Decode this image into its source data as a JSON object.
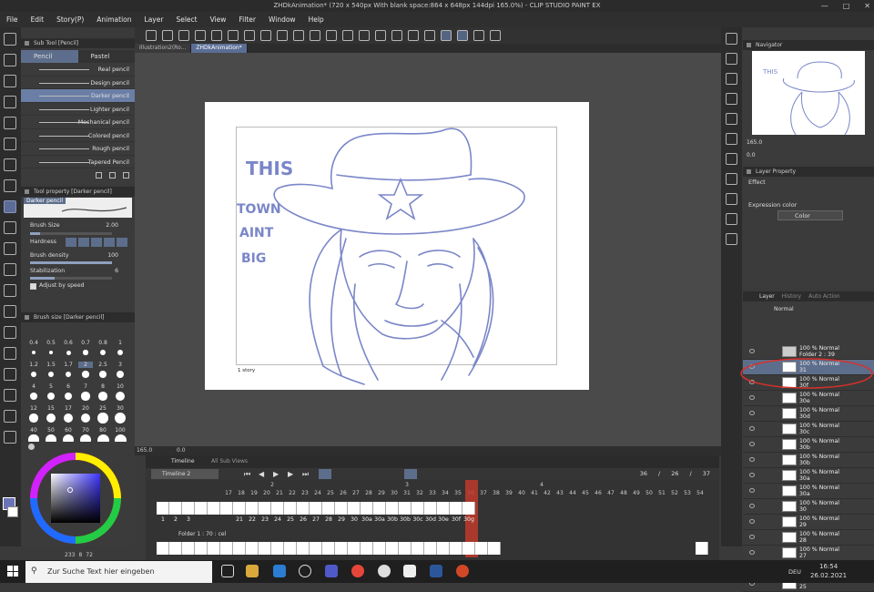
{
  "title": "ZHDkAnimation* (720 x 540px With blank space:864 x 648px 144dpi 165.0%) - CLIP STUDIO PAINT EX",
  "menu": [
    "File",
    "Edit",
    "Story(P)",
    "Animation",
    "Layer",
    "Select",
    "View",
    "Filter",
    "Window",
    "Help"
  ],
  "doc_tabs": [
    {
      "label": "Illustration2(Ro..."
    },
    {
      "label": "ZHDkAnimation*"
    }
  ],
  "subtool": {
    "header": "Sub Tool [Pencil]",
    "tabs": [
      "Pencil",
      "Pastel"
    ],
    "brushes": [
      "Real pencil",
      "Design pencil",
      "Darker pencil",
      "Lighter pencil",
      "Mechanical pencil",
      "Colored pencil",
      "Rough pencil",
      "Tapered Pencil"
    ],
    "selected": 2
  },
  "toolprop": {
    "header": "Tool property [Darker pencil]",
    "preset": "Darker pencil",
    "brush_size_label": "Brush Size",
    "brush_size": "2.00",
    "brush_size_level": 0.12,
    "hardness_label": "Hardness",
    "density_label": "Brush density",
    "density": "100",
    "density_level": 1.0,
    "stab_label": "Stabilization",
    "stab": "6",
    "stab_level": 0.3,
    "adjust": "Adjust by speed"
  },
  "brushsize": {
    "header": "Brush size [Darker pencil]",
    "sizes": [
      "0.4",
      "0.5",
      "0.6",
      "0.7",
      "0.8",
      "1",
      "1.2",
      "1.5",
      "1.7",
      "2",
      "2.5",
      "3",
      "4",
      "5",
      "6",
      "7",
      "8",
      "10",
      "12",
      "15",
      "17",
      "20",
      "25",
      "30",
      "40",
      "50",
      "60",
      "70",
      "80",
      "100"
    ]
  },
  "color_values": [
    "233",
    "8",
    "72"
  ],
  "canvas": {
    "story_label": "1 story"
  },
  "drawing_text": [
    "THIS",
    "TOWN",
    "AINT",
    "BIG"
  ],
  "status": {
    "zoom": "165.0",
    "angle": "0.0"
  },
  "timeline": {
    "header": "Timeline",
    "header2": "All Sub Views",
    "name": "Timeline 2",
    "counter": [
      "36",
      "/",
      "26",
      "/",
      "37"
    ],
    "frames": [
      "17",
      "18",
      "19",
      "20",
      "21",
      "22",
      "23",
      "24",
      "25",
      "26",
      "27",
      "28",
      "29",
      "30",
      "31",
      "32",
      "33",
      "34",
      "35",
      "36",
      "37",
      "38",
      "39",
      "40",
      "41",
      "42",
      "43",
      "44",
      "45",
      "46",
      "47",
      "48",
      "49",
      "50",
      "51",
      "52",
      "53",
      "54"
    ],
    "sec_marks": [
      "2",
      "3",
      "4"
    ],
    "cells": [
      "1",
      "2",
      "3",
      "",
      "",
      "",
      "21",
      "22",
      "23",
      "24",
      "25",
      "26",
      "27",
      "28",
      "29",
      "30",
      "30a",
      "30a",
      "30b",
      "30b",
      "30c",
      "30d",
      "30e",
      "30f",
      "30g"
    ],
    "folder_label": "Folder 1 : 70 : cel"
  },
  "navigator": {
    "header": "Navigator",
    "zoom": "165.0",
    "angle": "0.0"
  },
  "layerprop": {
    "header": "Layer Property",
    "effect": "Effect",
    "expr_label": "Expression color",
    "expr_value": "Color"
  },
  "layers": {
    "tabs": [
      "Layer",
      "History",
      "Auto Action"
    ],
    "blend": "Normal",
    "rows": [
      {
        "t1": "100 % Normal",
        "t2": "Folder 2 : 39",
        "folder": true
      },
      {
        "t1": "100 % Normal",
        "t2": "31",
        "sel": true
      },
      {
        "t1": "100 % Normal",
        "t2": "30f"
      },
      {
        "t1": "100 % Normal",
        "t2": "30e"
      },
      {
        "t1": "100 % Normal",
        "t2": "30d"
      },
      {
        "t1": "100 % Normal",
        "t2": "30c"
      },
      {
        "t1": "100 % Normal",
        "t2": "30b"
      },
      {
        "t1": "100 % Normal",
        "t2": "30b"
      },
      {
        "t1": "100 % Normal",
        "t2": "30a"
      },
      {
        "t1": "100 % Normal",
        "t2": "30a"
      },
      {
        "t1": "100 % Normal",
        "t2": "30"
      },
      {
        "t1": "100 % Normal",
        "t2": "29"
      },
      {
        "t1": "100 % Normal",
        "t2": "28"
      },
      {
        "t1": "100 % Normal",
        "t2": "27"
      },
      {
        "t1": "100 % Normal",
        "t2": "26"
      },
      {
        "t1": "100 % Normal",
        "t2": "25"
      }
    ]
  },
  "taskbar": {
    "search": "Zur Suche Text hier eingeben",
    "time": "16:54",
    "date": "26.02.2021",
    "lang": "DEU"
  },
  "colors": {
    "accent": "#5d6e8c",
    "stroke": "#7a86c8",
    "annot": "#d9302a"
  }
}
